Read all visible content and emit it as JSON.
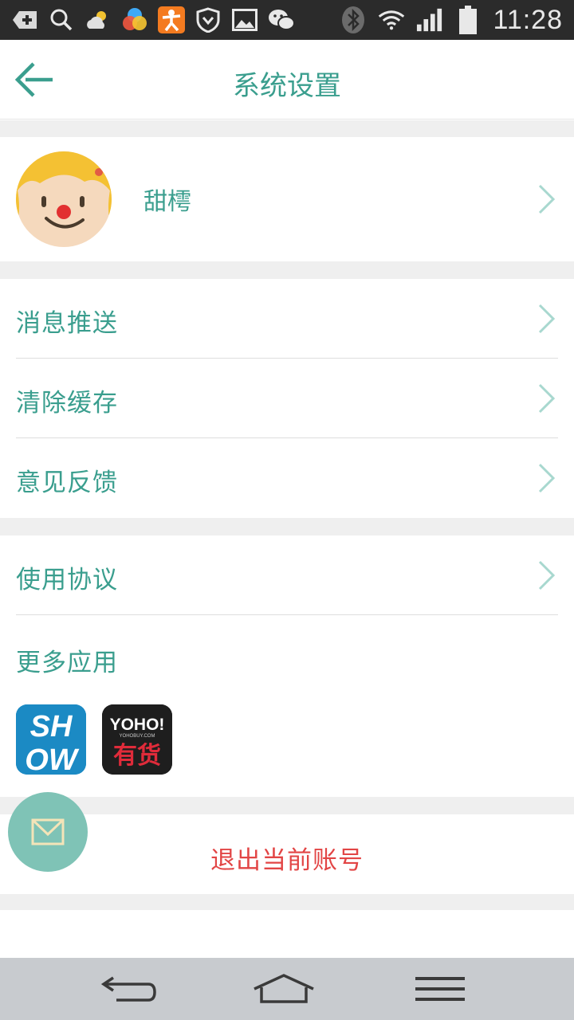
{
  "status_bar": {
    "time": "11:28",
    "icons": [
      "usb-debug-icon",
      "search-icon",
      "weather-icon",
      "color-app-icon",
      "fitness-app-icon",
      "shield-icon",
      "image-icon",
      "wechat-icon",
      "bluetooth-icon",
      "wifi-icon",
      "signal-icon",
      "battery-icon"
    ]
  },
  "header": {
    "title": "系统设置",
    "back_icon": "back-arrow-icon"
  },
  "profile": {
    "name": "甜樗",
    "avatar_icon": "clown-avatar-icon"
  },
  "menu": {
    "group1": [
      {
        "label": "消息推送"
      },
      {
        "label": "清除缓存"
      },
      {
        "label": "意见反馈"
      }
    ],
    "group2": [
      {
        "label": "使用协议"
      }
    ]
  },
  "more_apps": {
    "title": "更多应用",
    "apps": [
      {
        "name": "SHOW",
        "icon": "show-app-icon",
        "lines": [
          "SH",
          "OW"
        ]
      },
      {
        "name": "YOHO!有货",
        "icon": "yoho-app-icon",
        "top": "YOHO!",
        "sub": "YOHOBUY.COM",
        "bottom": "有货"
      }
    ]
  },
  "logout": {
    "label": "退出当前账号"
  },
  "fab": {
    "icon": "mail-icon"
  },
  "nav_bar": {
    "buttons": [
      "back-nav-icon",
      "home-nav-icon",
      "menu-nav-icon"
    ]
  },
  "colors": {
    "accent": "#3a9e8e",
    "logout": "#e24545",
    "fab": "#7fc3b6",
    "separator": "#efefef"
  }
}
